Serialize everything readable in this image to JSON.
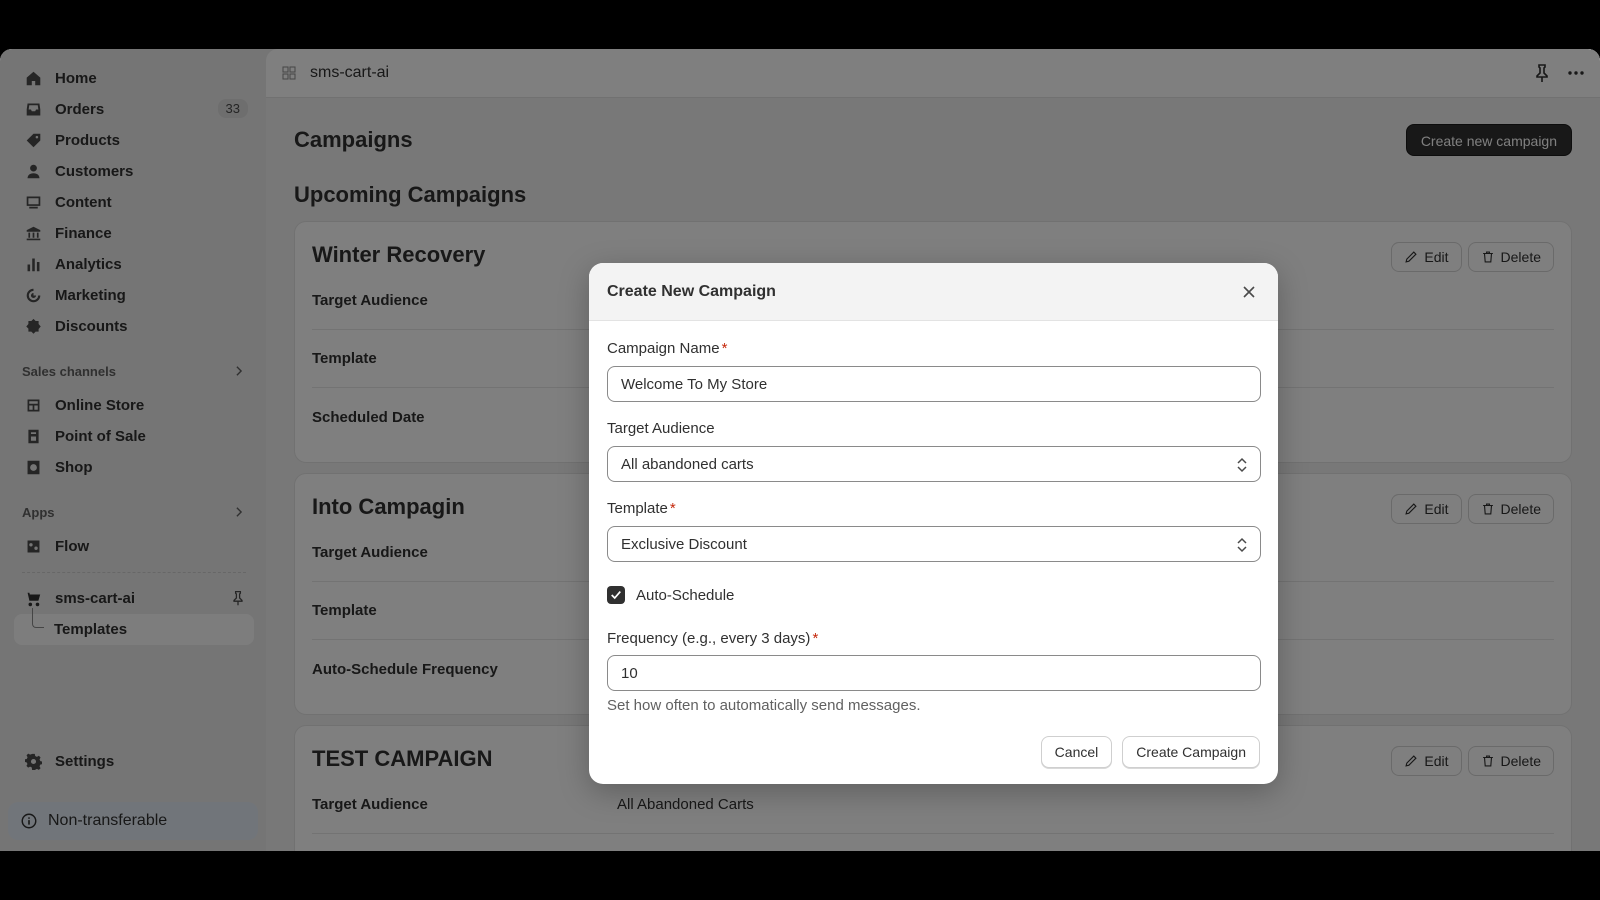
{
  "sidebar": {
    "nav": [
      {
        "label": "Home",
        "icon": "home-icon"
      },
      {
        "label": "Orders",
        "icon": "orders-icon",
        "badge": "33"
      },
      {
        "label": "Products",
        "icon": "tag-icon"
      },
      {
        "label": "Customers",
        "icon": "person-icon"
      },
      {
        "label": "Content",
        "icon": "content-icon"
      },
      {
        "label": "Finance",
        "icon": "bank-icon"
      },
      {
        "label": "Analytics",
        "icon": "bar-chart-icon"
      },
      {
        "label": "Marketing",
        "icon": "target-icon"
      },
      {
        "label": "Discounts",
        "icon": "discount-icon"
      }
    ],
    "sales_channels_label": "Sales channels",
    "channels": [
      {
        "label": "Online Store",
        "icon": "store-icon"
      },
      {
        "label": "Point of Sale",
        "icon": "pos-icon"
      },
      {
        "label": "Shop",
        "icon": "shop-icon"
      }
    ],
    "apps_label": "Apps",
    "apps": [
      {
        "label": "Flow",
        "icon": "flow-icon"
      }
    ],
    "current_app": {
      "label": "sms-cart-ai",
      "sub_item": "Templates"
    },
    "settings_label": "Settings",
    "non_transferable": "Non-transferable"
  },
  "topbar": {
    "app_title": "sms-cart-ai"
  },
  "page": {
    "title": "Campaigns",
    "create_button": "Create new campaign",
    "section_title": "Upcoming Campaigns",
    "edit_label": "Edit",
    "delete_label": "Delete",
    "cards": [
      {
        "name": "Winter Recovery",
        "rows": [
          {
            "label": "Target Audience",
            "value": ""
          },
          {
            "label": "Template",
            "value": ""
          },
          {
            "label": "Scheduled Date",
            "value": ""
          }
        ]
      },
      {
        "name": "Into Campagin",
        "rows": [
          {
            "label": "Target Audience",
            "value": ""
          },
          {
            "label": "Template",
            "value": ""
          },
          {
            "label": "Auto-Schedule Frequency",
            "value": ""
          }
        ]
      },
      {
        "name": "TEST CAMPAIGN",
        "rows": [
          {
            "label": "Target Audience",
            "value": "All Abandoned Carts"
          }
        ]
      }
    ]
  },
  "modal": {
    "title": "Create New Campaign",
    "campaign_name_label": "Campaign Name",
    "campaign_name_value": "Welcome To My Store",
    "target_audience_label": "Target Audience",
    "target_audience_value": "All abandoned carts",
    "template_label": "Template",
    "template_value": "Exclusive Discount",
    "auto_schedule_label": "Auto-Schedule",
    "auto_schedule_checked": true,
    "frequency_label": "Frequency (e.g., every 3 days)",
    "frequency_value": "10",
    "frequency_help": "Set how often to automatically send messages.",
    "cancel_label": "Cancel",
    "create_label": "Create Campaign",
    "required_mark": "*"
  }
}
